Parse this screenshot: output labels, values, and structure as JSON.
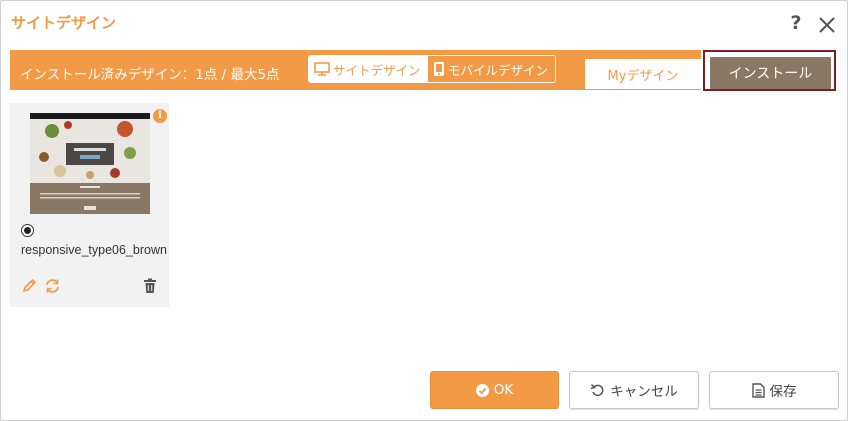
{
  "dialog": {
    "title": "サイトデザイン",
    "help_label": "?"
  },
  "toolbar": {
    "installed_label": "インストール済みデザイン：1点 / 最大5点",
    "site_design_label": "サイトデザイン",
    "mobile_design_label": "モバイルデザイン"
  },
  "tabs": {
    "my_design": "Myデザイン",
    "install": "インストール"
  },
  "design_card": {
    "name": "responsive_type06_brown",
    "info_label": "i",
    "selected": true
  },
  "footer": {
    "ok_label": "OK",
    "cancel_label": "キャンセル",
    "save_label": "保存"
  },
  "colors": {
    "accent": "#f39a47",
    "install_tab_bg": "#8b7766",
    "install_tab_border": "#7a1f1f",
    "card_bg": "#f2f2f2"
  },
  "icons": {
    "help": "question-icon",
    "close": "close-icon",
    "site_design": "monitor-icon",
    "mobile_design": "mobile-icon",
    "edit": "pencil-icon",
    "refresh": "refresh-icon",
    "delete": "trash-icon",
    "ok": "check-circle-icon",
    "cancel": "undo-icon",
    "save": "document-icon",
    "info": "info-icon"
  }
}
